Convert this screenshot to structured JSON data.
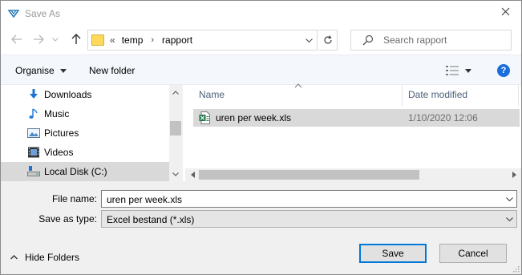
{
  "window": {
    "title": "Save As"
  },
  "address": {
    "overflow": "«",
    "crumbs": [
      "temp",
      "rapport"
    ]
  },
  "search": {
    "placeholder": "Search rapport"
  },
  "toolbar": {
    "organise_label": "Organise",
    "new_folder_label": "New folder",
    "help_label": "?"
  },
  "nav": {
    "items": [
      {
        "label": "Downloads",
        "icon": "download-icon"
      },
      {
        "label": "Music",
        "icon": "music-icon"
      },
      {
        "label": "Pictures",
        "icon": "pictures-icon"
      },
      {
        "label": "Videos",
        "icon": "videos-icon"
      },
      {
        "label": "Local Disk (C:)",
        "icon": "drive-icon",
        "selected": true
      }
    ]
  },
  "files": {
    "columns": {
      "name": "Name",
      "date_modified": "Date modified"
    },
    "rows": [
      {
        "name": "uren per week.xls",
        "date": "1/10/2020 12:06",
        "icon": "excel-file-icon"
      }
    ]
  },
  "form": {
    "file_name_label": "File name:",
    "file_name_value": "uren per week.xls",
    "save_type_label": "Save as type:",
    "save_type_value": "Excel bestand (*.xls)"
  },
  "footer": {
    "hide_folders_label": "Hide Folders",
    "save_label": "Save",
    "cancel_label": "Cancel"
  },
  "colors": {
    "accent": "#0078d7",
    "selection": "#d9d9d9",
    "toolbar_bg": "#f4f7fb",
    "footer_bg": "#f0f0f0"
  }
}
